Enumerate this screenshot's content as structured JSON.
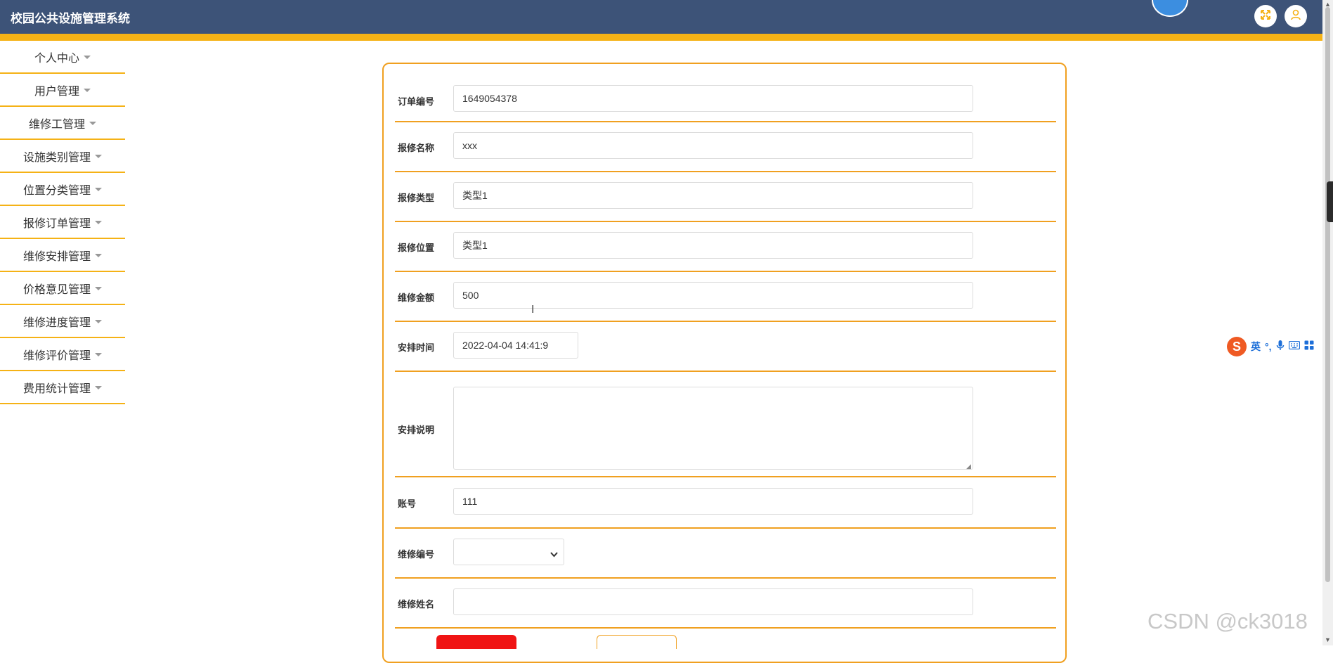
{
  "header": {
    "title": "校园公共设施管理系统",
    "colors": {
      "bar": "#3d5378",
      "stripe": "#f5b216",
      "accent": "#f5b216"
    },
    "icons": [
      "fullscreen-icon",
      "user-icon"
    ]
  },
  "sidebar": {
    "items": [
      {
        "label": "个人中心"
      },
      {
        "label": "用户管理"
      },
      {
        "label": "维修工管理"
      },
      {
        "label": "设施类别管理"
      },
      {
        "label": "位置分类管理"
      },
      {
        "label": "报修订单管理"
      },
      {
        "label": "维修安排管理"
      },
      {
        "label": "价格意见管理"
      },
      {
        "label": "维修进度管理"
      },
      {
        "label": "维修评价管理"
      },
      {
        "label": "费用统计管理"
      }
    ]
  },
  "form": {
    "order_no": {
      "label": "订单编号",
      "value": "1649054378"
    },
    "repair_name": {
      "label": "报修名称",
      "value": "xxx"
    },
    "repair_type": {
      "label": "报修类型",
      "value": "类型1"
    },
    "repair_location": {
      "label": "报修位置",
      "value": "类型1"
    },
    "repair_amount": {
      "label": "维修金额",
      "value": "500"
    },
    "schedule_time": {
      "label": "安排时间",
      "value": "2022-04-04 14:41:9"
    },
    "schedule_note": {
      "label": "安排说明",
      "value": ""
    },
    "account": {
      "label": "账号",
      "value": "111"
    },
    "repair_worker_no": {
      "label": "维修编号",
      "value": ""
    },
    "repair_worker_name": {
      "label": "维修姓名",
      "value": ""
    }
  },
  "ime": {
    "logo": "S",
    "lang": "英",
    "punct": "°,"
  },
  "watermark": "CSDN @ck3018"
}
